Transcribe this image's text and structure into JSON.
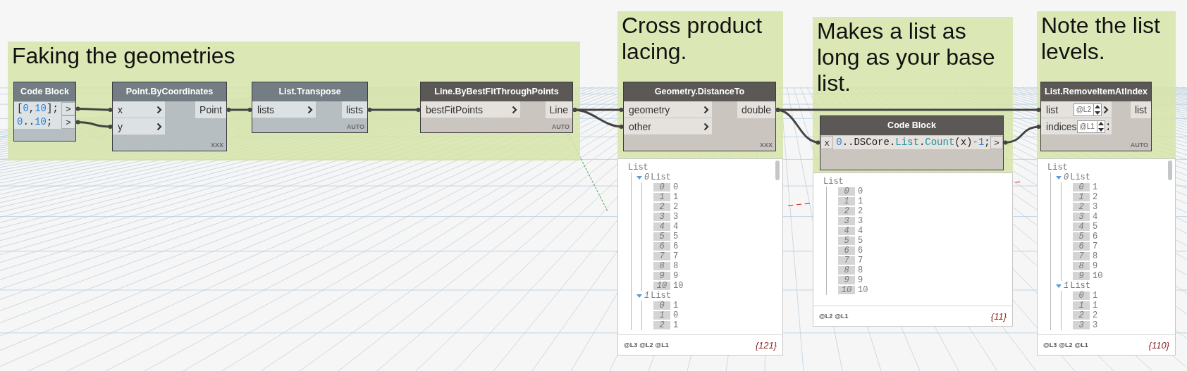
{
  "groups": [
    {
      "title": "Faking the geometries"
    },
    {
      "title": "Cross product lacing."
    },
    {
      "title": "Makes a list as long as your base list."
    },
    {
      "title": "Note the list levels."
    }
  ],
  "nodes": [
    {
      "kind": "code",
      "title": "Code Block",
      "preview": false,
      "lines": [
        {
          "tokens": [
            {
              "text": "[",
              "kind": "plain"
            },
            {
              "text": "0",
              "kind": "number"
            },
            {
              "text": ",",
              "kind": "plain"
            },
            {
              "text": "10",
              "kind": "number"
            },
            {
              "text": "];",
              "kind": "plain"
            }
          ],
          "output": ">"
        },
        {
          "tokens": [
            {
              "text": "0",
              "kind": "number"
            },
            {
              "text": "..",
              "kind": "plain"
            },
            {
              "text": "10",
              "kind": "number"
            },
            {
              "text": ";",
              "kind": "plain"
            }
          ],
          "output": ">"
        }
      ]
    },
    {
      "kind": "function",
      "title": "Point.ByCoordinates",
      "preview": false,
      "inputs": [
        {
          "name": "x"
        },
        {
          "name": "y"
        }
      ],
      "outputs": [
        "Point"
      ],
      "lacing": "XXX"
    },
    {
      "kind": "function",
      "title": "List.Transpose",
      "preview": false,
      "inputs": [
        {
          "name": "lists"
        }
      ],
      "outputs": [
        "lists"
      ],
      "lacing": "AUTO"
    },
    {
      "kind": "function",
      "title": "Line.ByBestFitThroughPoints",
      "preview": true,
      "inputs": [
        {
          "name": "bestFitPoints"
        }
      ],
      "outputs": [
        "Line"
      ],
      "lacing": "AUTO"
    },
    {
      "kind": "function",
      "title": "Geometry.DistanceTo",
      "preview": true,
      "inputs": [
        {
          "name": "geometry"
        },
        {
          "name": "other"
        }
      ],
      "outputs": [
        "double"
      ],
      "lacing": "XXX",
      "watch": {
        "root": "List",
        "items": [
          {
            "kind": "list",
            "index": "0",
            "label": "List",
            "expanded": true,
            "children": [
              {
                "index": "0",
                "value": "0"
              },
              {
                "index": "1",
                "value": "1"
              },
              {
                "index": "2",
                "value": "2"
              },
              {
                "index": "3",
                "value": "3"
              },
              {
                "index": "4",
                "value": "4"
              },
              {
                "index": "5",
                "value": "5"
              },
              {
                "index": "6",
                "value": "6"
              },
              {
                "index": "7",
                "value": "7"
              },
              {
                "index": "8",
                "value": "8"
              },
              {
                "index": "9",
                "value": "9"
              },
              {
                "index": "10",
                "value": "10"
              }
            ]
          },
          {
            "kind": "list",
            "index": "1",
            "label": "List",
            "expanded": true,
            "children": [
              {
                "index": "0",
                "value": "1"
              },
              {
                "index": "1",
                "value": "0"
              },
              {
                "index": "2",
                "value": "1"
              }
            ]
          }
        ],
        "levels": [
          "@L3",
          "@L2",
          "@L1"
        ],
        "count": "{121}"
      }
    },
    {
      "kind": "code",
      "title": "Code Block",
      "preview": true,
      "lines": [
        {
          "input": "x",
          "tokens": [
            {
              "text": "0",
              "kind": "number"
            },
            {
              "text": "..DSCore.",
              "kind": "plain"
            },
            {
              "text": "List",
              "kind": "type"
            },
            {
              "text": ".",
              "kind": "plain"
            },
            {
              "text": "Count",
              "kind": "type"
            },
            {
              "text": "(x)",
              "kind": "plain"
            },
            {
              "text": "-1",
              "kind": "number"
            },
            {
              "text": ";",
              "kind": "plain"
            }
          ],
          "output": ">"
        }
      ],
      "watch": {
        "root": "List",
        "items": [
          {
            "kind": "value",
            "index": "0",
            "value": "0"
          },
          {
            "kind": "value",
            "index": "1",
            "value": "1"
          },
          {
            "kind": "value",
            "index": "2",
            "value": "2"
          },
          {
            "kind": "value",
            "index": "3",
            "value": "3"
          },
          {
            "kind": "value",
            "index": "4",
            "value": "4"
          },
          {
            "kind": "value",
            "index": "5",
            "value": "5"
          },
          {
            "kind": "value",
            "index": "6",
            "value": "6"
          },
          {
            "kind": "value",
            "index": "7",
            "value": "7"
          },
          {
            "kind": "value",
            "index": "8",
            "value": "8"
          },
          {
            "kind": "value",
            "index": "9",
            "value": "9"
          },
          {
            "kind": "value",
            "index": "10",
            "value": "10"
          }
        ],
        "levels": [
          "@L2",
          "@L1"
        ],
        "count": "{11}"
      }
    },
    {
      "kind": "function",
      "title": "List.RemoveItemAtIndex",
      "preview": true,
      "inputs": [
        {
          "name": "list",
          "level": "@L2"
        },
        {
          "name": "indices",
          "level": "@L1"
        }
      ],
      "outputs": [
        "list"
      ],
      "lacing": "AUTO",
      "watch": {
        "root": "List",
        "items": [
          {
            "kind": "list",
            "index": "0",
            "label": "List",
            "expanded": true,
            "children": [
              {
                "index": "0",
                "value": "1"
              },
              {
                "index": "1",
                "value": "2"
              },
              {
                "index": "2",
                "value": "3"
              },
              {
                "index": "3",
                "value": "4"
              },
              {
                "index": "4",
                "value": "5"
              },
              {
                "index": "5",
                "value": "6"
              },
              {
                "index": "6",
                "value": "7"
              },
              {
                "index": "7",
                "value": "8"
              },
              {
                "index": "8",
                "value": "9"
              },
              {
                "index": "9",
                "value": "10"
              }
            ]
          },
          {
            "kind": "list",
            "index": "1",
            "label": "List",
            "expanded": true,
            "children": [
              {
                "index": "0",
                "value": "1"
              },
              {
                "index": "1",
                "value": "1"
              },
              {
                "index": "2",
                "value": "2"
              },
              {
                "index": "3",
                "value": "3"
              }
            ]
          }
        ],
        "levels": [
          "@L3",
          "@L2",
          "@L1"
        ],
        "count": "{110}"
      }
    }
  ]
}
